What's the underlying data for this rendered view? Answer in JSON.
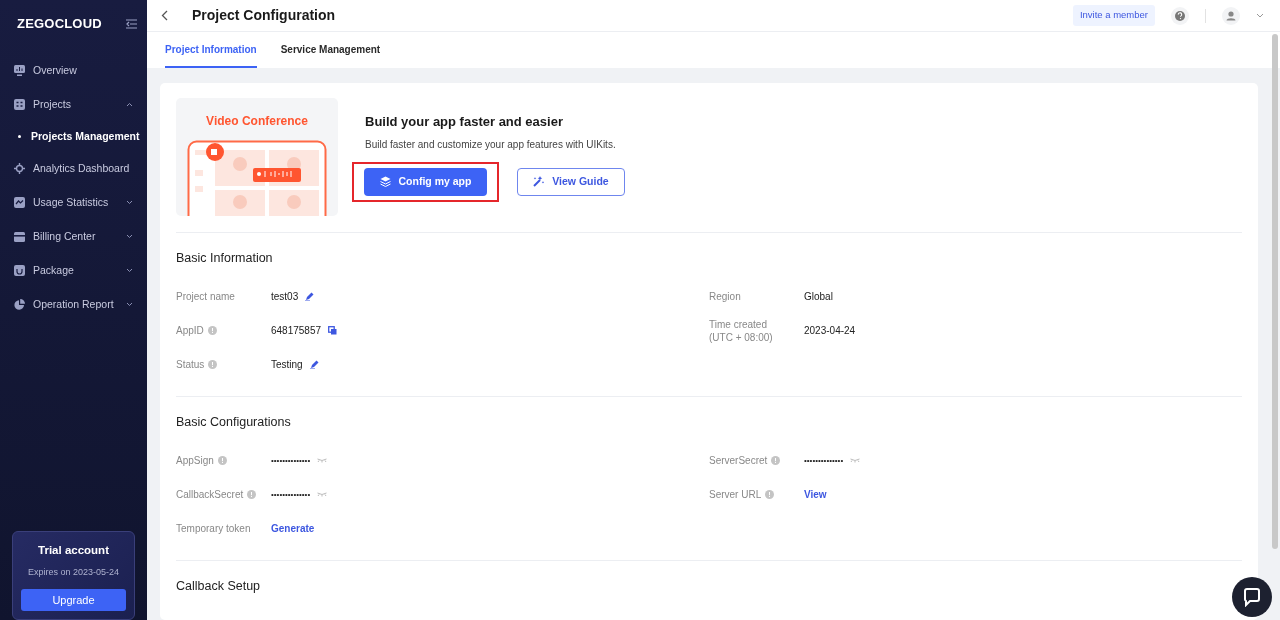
{
  "sidebar": {
    "logo": "ZEGOCLOUD",
    "items": [
      {
        "kind": "link",
        "label": "Overview",
        "selected": false
      },
      {
        "kind": "group",
        "label": "Projects",
        "selected": false,
        "expanded": true,
        "children": [
          {
            "label": "Projects Management",
            "selected": true
          }
        ]
      },
      {
        "kind": "link",
        "label": "Analytics Dashboard",
        "selected": false
      },
      {
        "kind": "group",
        "label": "Usage Statistics",
        "selected": false,
        "expanded": false
      },
      {
        "kind": "group",
        "label": "Billing Center",
        "selected": false,
        "expanded": false
      },
      {
        "kind": "group",
        "label": "Package",
        "selected": false,
        "expanded": false
      },
      {
        "kind": "group",
        "label": "Operation Report",
        "selected": false,
        "expanded": false
      }
    ],
    "trial": {
      "title": "Trial account",
      "expires": "Expires on 2023-05-24",
      "button": "Upgrade"
    }
  },
  "header": {
    "title": "Project Configuration",
    "invite_button": "Invite a member"
  },
  "tabs": [
    {
      "label": "Project Information",
      "selected": true
    },
    {
      "label": "Service Management",
      "selected": false
    }
  ],
  "promo": {
    "illustration_title": "Video Conference",
    "heading": "Build your app faster and easier",
    "text": "Build faster and customize your app features with UIKits.",
    "buttons": [
      {
        "kind": "primary",
        "label": "Config my app",
        "highlighted": true
      },
      {
        "kind": "outline",
        "label": "View Guide",
        "highlighted": false
      }
    ]
  },
  "sections": [
    {
      "title": "Basic Information",
      "left": [
        {
          "label": "Project name",
          "info": false,
          "kind": "editable",
          "value": "test03"
        },
        {
          "label": "AppID",
          "info": true,
          "kind": "copyable",
          "value": "648175857"
        },
        {
          "label": "Status",
          "info": true,
          "kind": "editable",
          "value": "Testing"
        }
      ],
      "right": [
        {
          "label": "Region",
          "info": false,
          "kind": "plain",
          "value": "Global"
        },
        {
          "label": "Time created",
          "sublabel": "(UTC + 08:00)",
          "info": false,
          "kind": "plain",
          "value": "2023-04-24"
        }
      ]
    },
    {
      "title": "Basic Configurations",
      "left": [
        {
          "label": "AppSign",
          "info": true,
          "kind": "secret",
          "value": "••••••••••••••"
        },
        {
          "label": "CallbackSecret",
          "info": true,
          "kind": "secret",
          "value": "••••••••••••••"
        },
        {
          "label": "Temporary token",
          "info": false,
          "kind": "link",
          "value": "Generate"
        }
      ],
      "right": [
        {
          "label": "ServerSecret",
          "info": true,
          "kind": "secret",
          "value": "••••••••••••••"
        },
        {
          "label": "Server URL",
          "info": true,
          "kind": "link",
          "value": "View"
        }
      ]
    },
    {
      "title": "Callback Setup"
    }
  ]
}
